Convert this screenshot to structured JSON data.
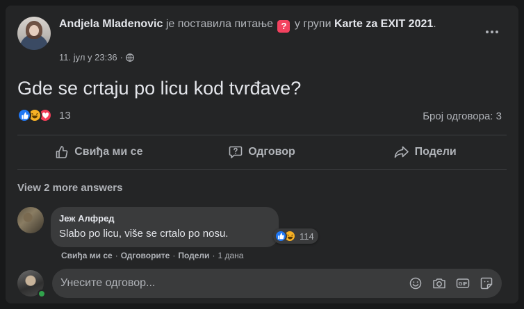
{
  "post": {
    "author": "Andjela Mladenovic",
    "verb_phrase": "је поставила питање",
    "in_group": "у групи",
    "group": "Karte za EXIT 2021",
    "group_suffix": ".",
    "timestamp": "11. јул у 23:36",
    "separator": "·",
    "question": "Gde se crtaju po licu kod tvrđave?",
    "reaction_count": "13",
    "answer_count": "Број одговора: 3",
    "privacy_icon": "globe-icon"
  },
  "actions": {
    "like": "Свиђа ми се",
    "answer": "Одговор",
    "share": "Подели"
  },
  "comments": {
    "view_more": "View 2 more answers",
    "items": [
      {
        "author": "Јеж Алфред",
        "text": "Slabo po licu, više se crtalo po nosu.",
        "reaction_count": "114",
        "like": "Свиђа ми се",
        "reply": "Одговорите",
        "share": "Подели",
        "age": "1 дана",
        "dot": "·"
      }
    ]
  },
  "composer": {
    "placeholder": "Унесите одговор..."
  },
  "colors": {
    "background": "#18191a",
    "card": "#242526",
    "bubble": "#3a3b3c",
    "text": "#e4e6eb",
    "muted": "#b0b3b8",
    "like": "#2078f4",
    "haha": "#f7b125",
    "love": "#f33e58",
    "online": "#31a24c"
  }
}
